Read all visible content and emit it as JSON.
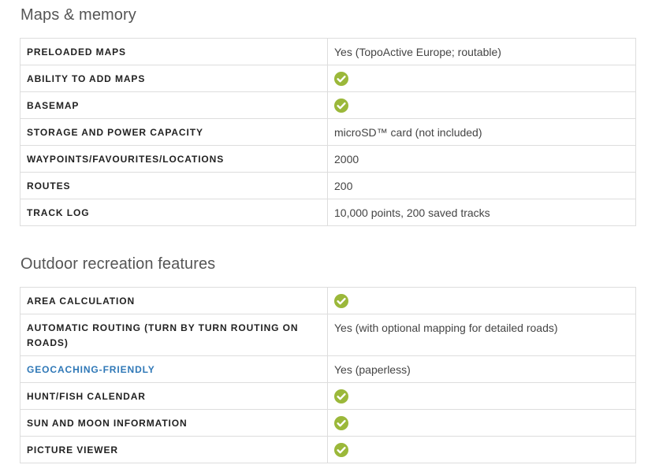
{
  "sections": [
    {
      "title": "Maps & memory",
      "rows": [
        {
          "label": "PRELOADED MAPS",
          "value": "Yes (TopoActive Europe; routable)"
        },
        {
          "label": "ABILITY TO ADD MAPS",
          "value": "",
          "icon": "check-icon"
        },
        {
          "label": "BASEMAP",
          "value": "",
          "icon": "check-icon"
        },
        {
          "label": "STORAGE AND POWER CAPACITY",
          "value": "microSD™ card (not included)"
        },
        {
          "label": "WAYPOINTS/FAVOURITES/LOCATIONS",
          "value": "2000"
        },
        {
          "label": "ROUTES",
          "value": "200"
        },
        {
          "label": "TRACK LOG",
          "value": "10,000 points, 200 saved tracks"
        }
      ]
    },
    {
      "title": "Outdoor recreation features",
      "rows": [
        {
          "label": "AREA CALCULATION",
          "value": "",
          "icon": "check-icon"
        },
        {
          "label": "AUTOMATIC ROUTING (TURN BY TURN ROUTING ON ROADS)",
          "value": "Yes (with optional mapping for detailed roads)"
        },
        {
          "label": "GEOCACHING-FRIENDLY",
          "value": "Yes (paperless)",
          "link": true
        },
        {
          "label": "HUNT/FISH CALENDAR",
          "value": "",
          "icon": "check-icon"
        },
        {
          "label": "SUN AND MOON INFORMATION",
          "value": "",
          "icon": "check-icon"
        },
        {
          "label": "PICTURE VIEWER",
          "value": "",
          "icon": "check-icon"
        }
      ]
    }
  ],
  "colors": {
    "check": "#9bb83a",
    "link": "#2f78b7",
    "border": "#dddddd"
  }
}
